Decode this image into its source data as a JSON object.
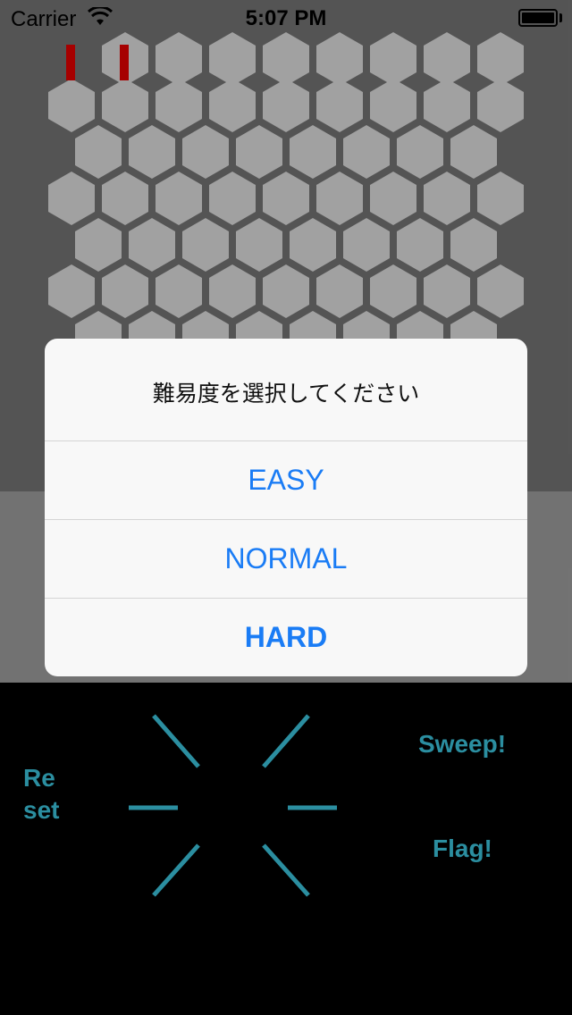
{
  "status_bar": {
    "carrier": "Carrier",
    "time": "5:07 PM",
    "icons": [
      "wifi-icon",
      "battery-icon"
    ]
  },
  "board": {
    "cell_color": "#9e9e9e",
    "background_color": "#4f4f4f",
    "flag_color": "#a60000"
  },
  "dialog": {
    "title": "難易度を選択してください",
    "options": [
      {
        "label": "EASY"
      },
      {
        "label": "NORMAL"
      },
      {
        "label": "HARD"
      }
    ]
  },
  "controls": {
    "reset_line1": "Re",
    "reset_line2": "set",
    "sweep_label": "Sweep!",
    "flag_label": "Flag!",
    "accent_color": "#2b8ea0",
    "dial_icon": "direction-dial-icon"
  }
}
